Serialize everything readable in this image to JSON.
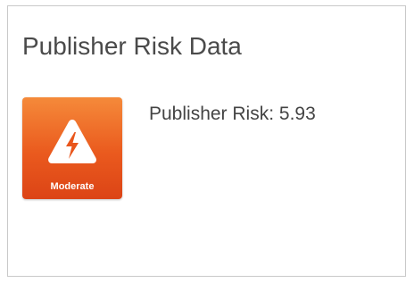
{
  "card": {
    "title": "Publisher Risk Data"
  },
  "risk": {
    "level_label": "Moderate",
    "icon": "warning-lightning-icon",
    "label": "Publisher Risk:",
    "score": "5.93",
    "badge_color": "#ea5a1e"
  }
}
